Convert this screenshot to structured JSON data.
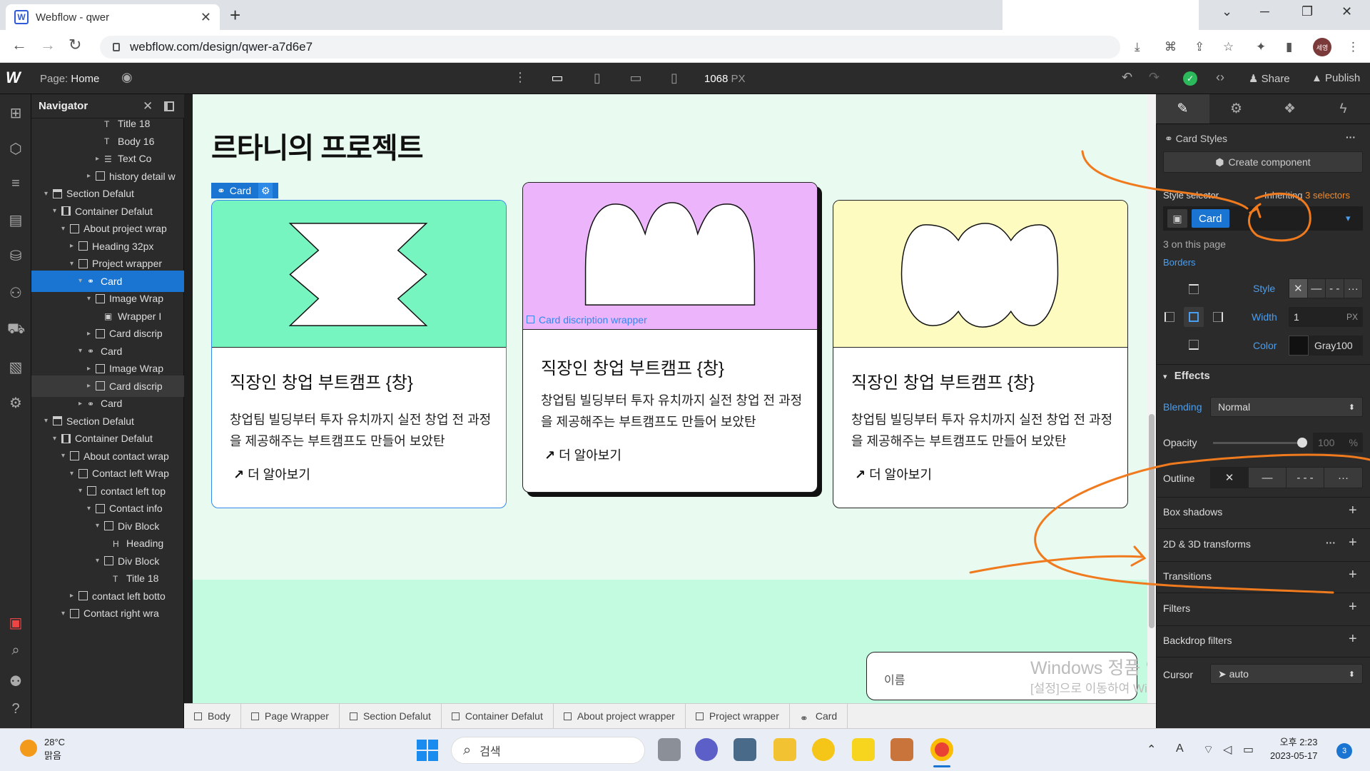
{
  "browser": {
    "tab_title": "Webflow - qwer",
    "tab_favicon": "W",
    "tab_close": "✕",
    "new_tab": "+",
    "url": "webflow.com/design/qwer-a7d6e7",
    "profile_initials": "세영"
  },
  "topbar": {
    "page_label": "Page:",
    "page_name": "Home",
    "width_value": "1068",
    "width_unit": "PX",
    "share_label": "Share",
    "publish_label": "Publish"
  },
  "navigator": {
    "title": "Navigator",
    "items": [
      {
        "label": "Title 18",
        "indent": 7,
        "icon": "textblock",
        "caret": ""
      },
      {
        "label": "Body 16",
        "indent": 7,
        "icon": "textblock",
        "caret": ""
      },
      {
        "label": "Text Co",
        "indent": 7,
        "icon": "list",
        "caret": "▸"
      },
      {
        "label": "history detail w",
        "indent": 6,
        "icon": "box",
        "caret": "▸"
      },
      {
        "label": "Section Defalut",
        "indent": 1,
        "icon": "section",
        "caret": "▾"
      },
      {
        "label": "Container Defalut",
        "indent": 2,
        "icon": "container",
        "caret": "▾"
      },
      {
        "label": "About project wrap",
        "indent": 3,
        "icon": "box",
        "caret": "▾"
      },
      {
        "label": "Heading 32px",
        "indent": 4,
        "icon": "box",
        "caret": "▸"
      },
      {
        "label": "Project wrapper",
        "indent": 4,
        "icon": "box",
        "caret": "▾"
      },
      {
        "label": "Card",
        "indent": 5,
        "icon": "link",
        "caret": "▾",
        "selected": true
      },
      {
        "label": "Image Wrap",
        "indent": 6,
        "icon": "box",
        "caret": "▾"
      },
      {
        "label": "Wrapper I",
        "indent": 7,
        "icon": "image",
        "caret": ""
      },
      {
        "label": "Card discrip",
        "indent": 6,
        "icon": "box",
        "caret": "▸"
      },
      {
        "label": "Card",
        "indent": 5,
        "icon": "link",
        "caret": "▾"
      },
      {
        "label": "Image Wrap",
        "indent": 6,
        "icon": "box",
        "caret": "▸"
      },
      {
        "label": "Card discrip",
        "indent": 6,
        "icon": "box",
        "caret": "▸",
        "hover": true
      },
      {
        "label": "Card",
        "indent": 5,
        "icon": "link",
        "caret": "▸"
      },
      {
        "label": "Section Defalut",
        "indent": 1,
        "icon": "section",
        "caret": "▾"
      },
      {
        "label": "Container Defalut",
        "indent": 2,
        "icon": "container",
        "caret": "▾"
      },
      {
        "label": "About contact wrap",
        "indent": 3,
        "icon": "box",
        "caret": "▾"
      },
      {
        "label": "Contact left Wrap",
        "indent": 4,
        "icon": "box",
        "caret": "▾"
      },
      {
        "label": "contact left top",
        "indent": 5,
        "icon": "box",
        "caret": "▾"
      },
      {
        "label": "Contact info",
        "indent": 6,
        "icon": "box",
        "caret": "▾"
      },
      {
        "label": "Div Block",
        "indent": 7,
        "icon": "box",
        "caret": "▾"
      },
      {
        "label": "Heading",
        "indent": 8,
        "icon": "heading",
        "caret": ""
      },
      {
        "label": "Div Block",
        "indent": 7,
        "icon": "box",
        "caret": "▾"
      },
      {
        "label": "Title 18",
        "indent": 8,
        "icon": "textblock",
        "caret": ""
      },
      {
        "label": "contact left botto",
        "indent": 4,
        "icon": "box",
        "caret": "▸"
      },
      {
        "label": "Contact right wra",
        "indent": 3,
        "icon": "box",
        "caret": "▾"
      }
    ]
  },
  "canvas": {
    "heading": "르타니의 프로젝트",
    "card_tag_label": "Card",
    "card_description_wrapper_label": "Card discription wrapper",
    "cards": [
      {
        "title": "직장인 창업 부트캠프 {창}",
        "desc": "창업팀 빌딩부터 투자 유치까지 실전 창업 전 과정을 제공해주는 부트캠프도 만들어 보았탄",
        "link": "더 알아보기",
        "color": "#76f5c0"
      },
      {
        "title": "직장인 창업 부트캠프 {창}",
        "desc": "창업팀 빌딩부터 투자 유치까지 실전 창업 전 과정을 제공해주는 부트캠프도 만들어 보았탄",
        "link": "더 알아보기",
        "color": "#ebb4fb"
      },
      {
        "title": "직장인 창업 부트캠프 {창}",
        "desc": "창업팀 빌딩부터 투자 유치까지 실전 창업 전 과정을 제공해주는 부트캠프도 만들어 보았탄",
        "link": "더 알아보기",
        "color": "#fdfbc0"
      }
    ],
    "name_field_placeholder": "이름",
    "watermark_line1": "Windows 정품 인증",
    "watermark_line2": "[설정]으로 이동하여 Windows를 정품 인증합니다."
  },
  "breadcrumb": [
    "Body",
    "Page Wrapper",
    "Section Defalut",
    "Container Defalut",
    "About project wrapper",
    "Project wrapper",
    "Card"
  ],
  "stylepanel": {
    "card_styles_label": "Card Styles",
    "more": "···",
    "create_component": "Create component",
    "style_selector_label": "Style selector",
    "inheriting_label": "Inheriting",
    "selectors_count": "3 selectors",
    "selector_chip": "Card",
    "on_page": "3 on this page",
    "borders_label": "Borders",
    "style_label": "Style",
    "width_label": "Width",
    "width_value": "1",
    "width_unit": "PX",
    "color_label": "Color",
    "color_value": "Gray100",
    "effects_label": "Effects",
    "blending_label": "Blending",
    "blending_value": "Normal",
    "opacity_label": "Opacity",
    "opacity_value": "100",
    "opacity_unit": "%",
    "outline_label": "Outline",
    "box_shadows_label": "Box shadows",
    "transforms_label": "2D & 3D transforms",
    "transitions_label": "Transitions",
    "filters_label": "Filters",
    "backdrop_filters_label": "Backdrop filters",
    "cursor_label": "Cursor",
    "cursor_value": "auto"
  },
  "taskbar": {
    "temperature": "28°C",
    "weather": "맑음",
    "search_label": "검색",
    "time": "오후 2:23",
    "date": "2023-05-17",
    "notifications": "3",
    "ime": "A"
  },
  "colors": {
    "accent": "#1a75d2",
    "annotation": "#f07a1e",
    "canvas_bg": "#e9fbf1"
  }
}
